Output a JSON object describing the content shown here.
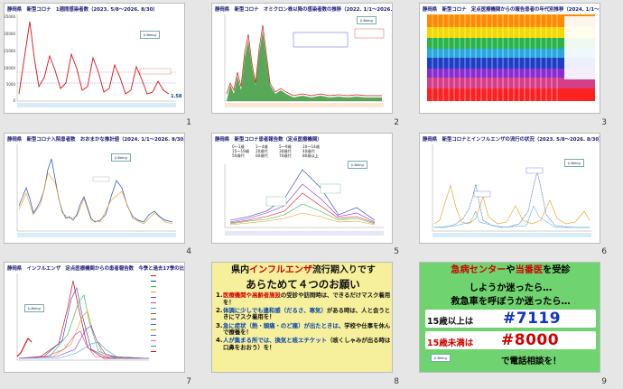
{
  "slides": [
    {
      "number": "1",
      "title": "静岡県　新型コロナ　1週間感染者数（2023. 5/8～2026. 8/30）"
    },
    {
      "number": "2",
      "title": "静岡県　新型コロナ　オミクロン株以降の感染者数の推移（2022. 1/1～2026. 8/30）"
    },
    {
      "number": "3",
      "title": "静岡県　新型コロナ　定点医療機関からの報告患者の年代別推移（2024. 1/1～2026. 8/30）"
    },
    {
      "number": "4",
      "title": "静岡県　新型コロナ入院患者数　おおまかな推計値（2024. 1/1～2026. 8/30）"
    },
    {
      "number": "5",
      "title": "静岡県　新型コロナ患者報告数（定点医療機関）"
    },
    {
      "number": "6",
      "title": "静岡県　新型コロナとインフルエンザの流行の状況（2023. 5/8～2026. 8/30）"
    },
    {
      "number": "7",
      "title": "静岡県　インフルエンザ　定点医療機関からの患者報告数　今季と過去17季の比較"
    },
    {
      "number": "8"
    },
    {
      "number": "9"
    }
  ],
  "slide1": {
    "value_label": "1.58",
    "y_ticks": [
      "25000",
      "20000",
      "15000",
      "10000",
      "5000",
      "0"
    ]
  },
  "slide5": {
    "legend": [
      "0～1歳",
      "1～4歳",
      "5～9歳",
      "10～14歳",
      "15～19歳",
      "20歳代",
      "30歳代",
      "40歳代",
      "50歳代",
      "60歳代",
      "70歳代",
      "80歳以上"
    ]
  },
  "slide8": {
    "header_pre": "県内",
    "header_red": "インフルエンザ",
    "header_post": "流行期入りです",
    "subheader": "あらためて４つのお願い",
    "items": [
      {
        "n": "1.",
        "blue": "医療機関や高齢者施設",
        "rest": "の受診や訪問時は、できるだけマスク着用を！"
      },
      {
        "n": "2.",
        "blue": "体調に少しでも違和感（だるさ、寒気）",
        "rest": "がある時は、人と会うときにマスク着用を！"
      },
      {
        "n": "3.",
        "blue": "急に症状（熱・頭痛・のど痛）が出たときは",
        "rest": "、学校や仕事を休んで療養を！"
      },
      {
        "n": "4.",
        "blue": "人が集まる所では、換気と咳エチケット",
        "rest": "（咳くしゃみが出る時は口鼻をおおう）を！"
      }
    ]
  },
  "slide9": {
    "line1_red1": "急病センター",
    "line1_mid": "や",
    "line1_red2": "当番医",
    "line1_post": "を受診",
    "line2": "しようか迷ったら…",
    "line3": "救急車を呼ぼうか迷ったら…",
    "age_over": "15歳以上は",
    "number_over": "#7119",
    "age_under": "15歳未満は",
    "number_under": "#8000",
    "footer": "で電話相談を！"
  },
  "logo_text": "Ji-Being"
}
